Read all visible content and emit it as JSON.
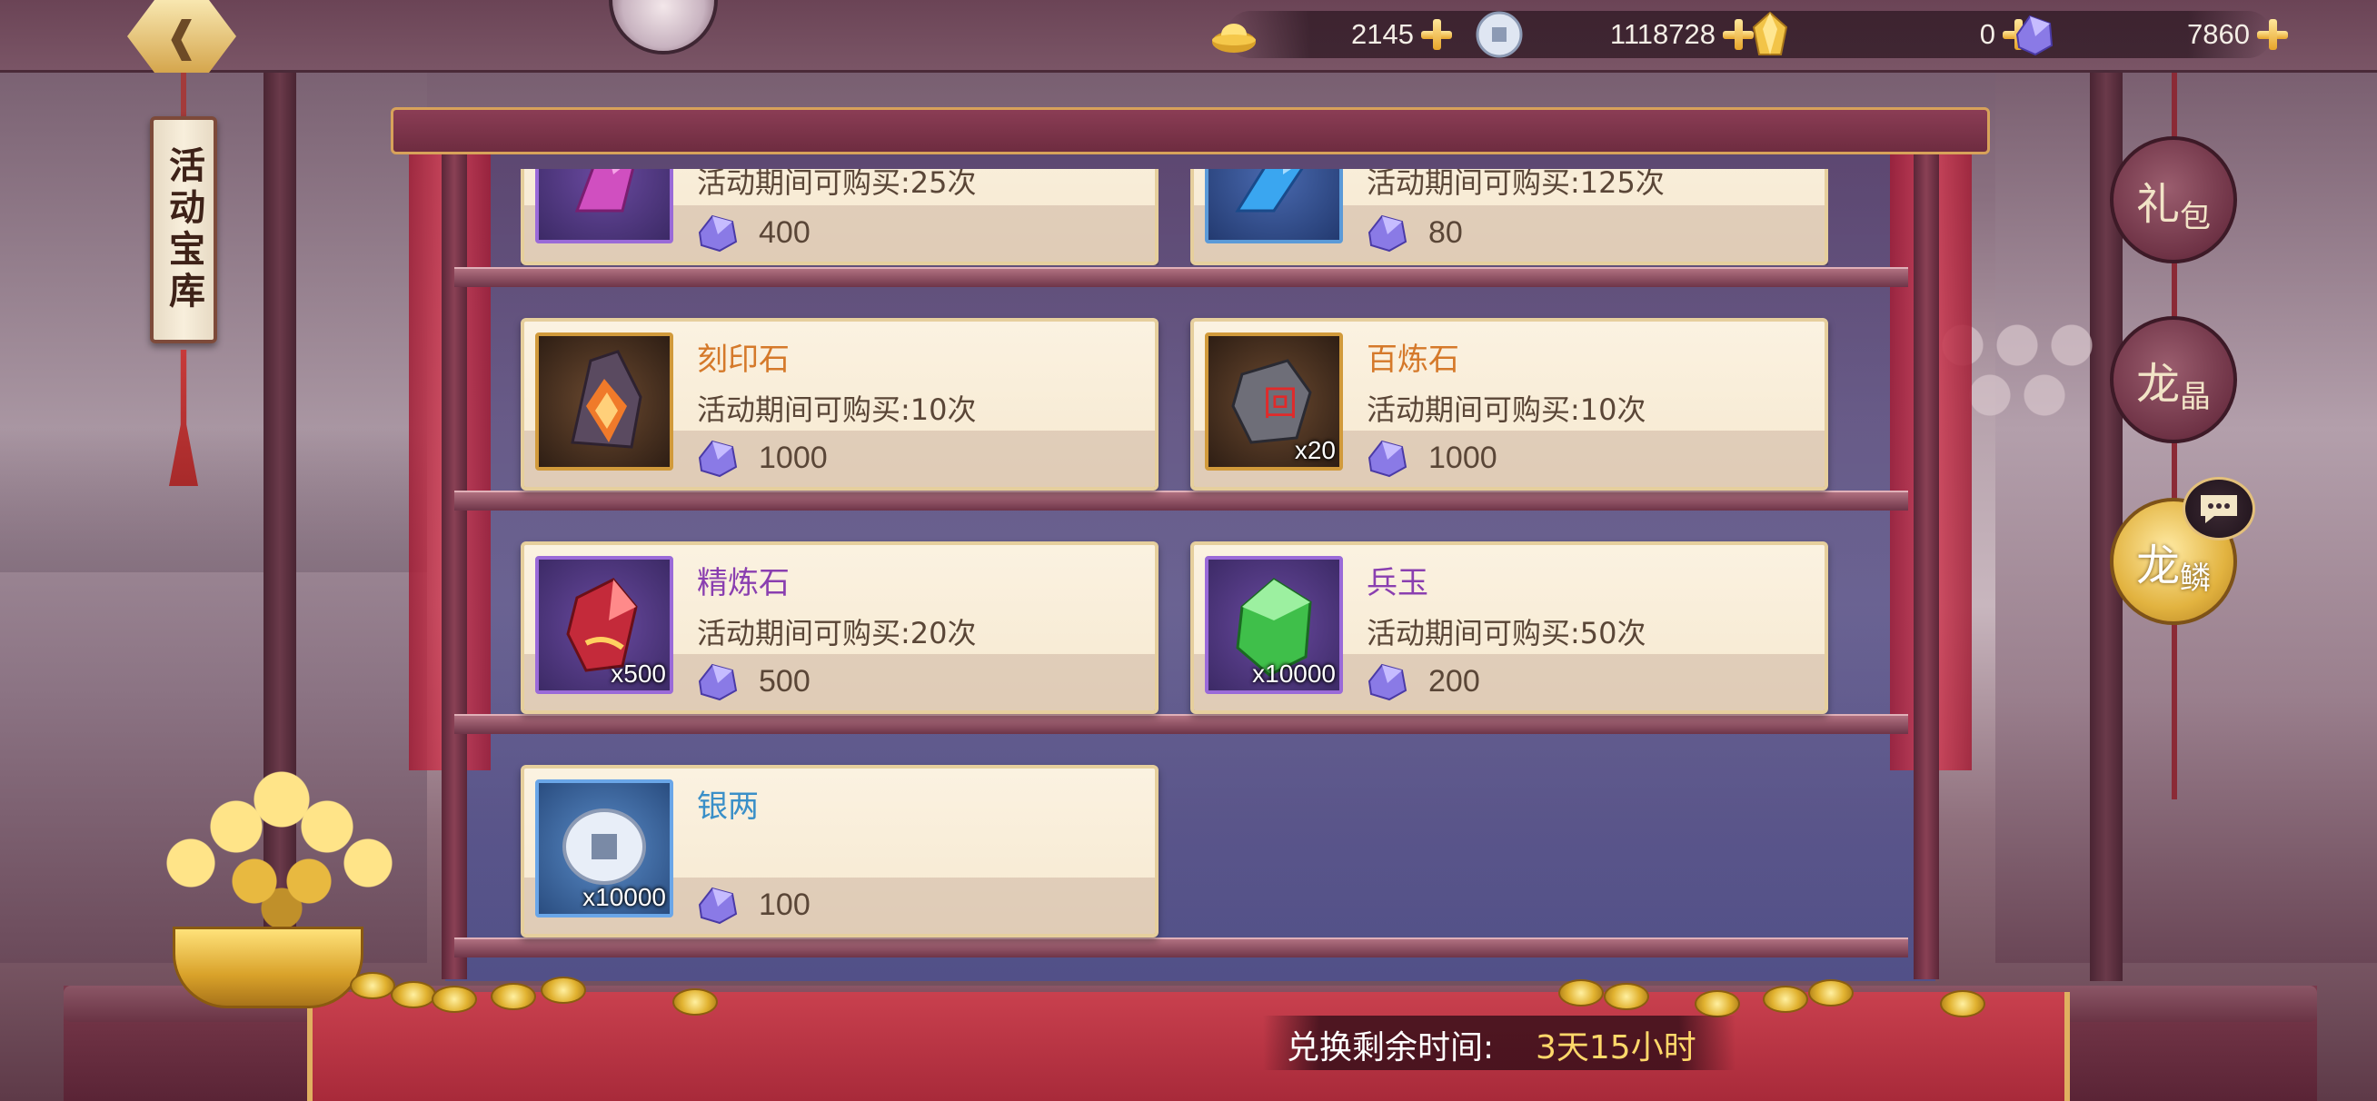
{
  "header": {
    "back_icon": "back-arrow-icon",
    "title": "活动宝库"
  },
  "resources": [
    {
      "name": "gold-ingot",
      "icon": "gold-ingot-icon",
      "value": "2145"
    },
    {
      "name": "silver-coin",
      "icon": "silver-coin-icon",
      "value": "1118728"
    },
    {
      "name": "gold-crystal",
      "icon": "gold-crystal-icon",
      "value": "0"
    },
    {
      "name": "dragon-crystal",
      "icon": "purple-crystal-icon",
      "value": "7860"
    }
  ],
  "items": [
    {
      "name": "",
      "limit": "活动期间可购买:25次",
      "price": "400",
      "qty": "",
      "icon": "pink-crystal-icon",
      "name_color": "#8a3fb0"
    },
    {
      "name": "",
      "limit": "活动期间可购买:125次",
      "price": "80",
      "qty": "",
      "icon": "blue-crystal-icon",
      "name_color": "#3a78c0"
    },
    {
      "name": "刻印石",
      "limit": "活动期间可购买:10次",
      "price": "1000",
      "qty": "",
      "icon": "engraving-stone-icon",
      "name_color": "#d5792a"
    },
    {
      "name": "百炼石",
      "limit": "活动期间可购买:10次",
      "price": "1000",
      "qty": "x20",
      "icon": "refining-stone-icon",
      "name_color": "#d5792a"
    },
    {
      "name": "精炼石",
      "limit": "活动期间可购买:20次",
      "price": "500",
      "qty": "x500",
      "icon": "red-gem-icon",
      "name_color": "#8a3fb0"
    },
    {
      "name": "兵玉",
      "limit": "活动期间可购买:50次",
      "price": "200",
      "qty": "x10000",
      "icon": "green-jade-icon",
      "name_color": "#8a3fb0"
    },
    {
      "name": "银两",
      "limit": "",
      "price": "100",
      "qty": "x10000",
      "icon": "silver-coin-icon",
      "name_color": "#3a8fc8"
    }
  ],
  "price_currency_icon": "purple-crystal-icon",
  "side_tabs": [
    {
      "big": "礼",
      "small": "包",
      "active": false
    },
    {
      "big": "龙",
      "small": "晶",
      "active": false
    },
    {
      "big": "龙",
      "small": "鳞",
      "active": true
    }
  ],
  "timer": {
    "label": "兑换剩余时间:",
    "value": "3天15小时"
  }
}
